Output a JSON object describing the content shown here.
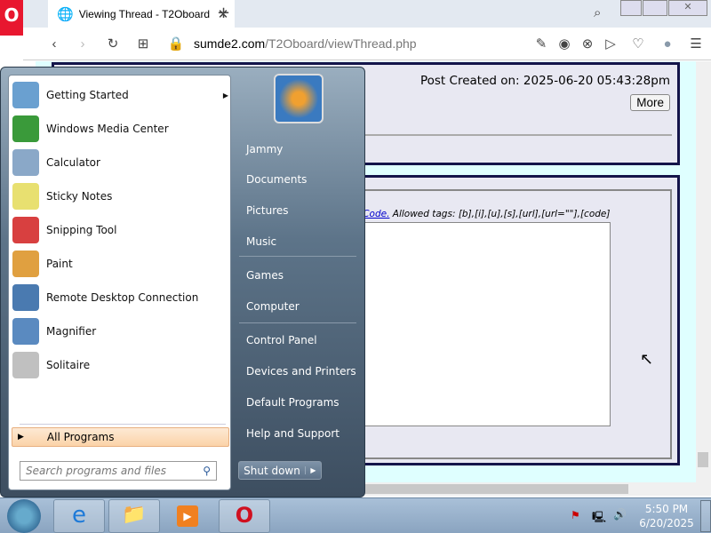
{
  "browser": {
    "tab_title": "Viewing Thread - T2Oboard",
    "url_domain": "sumde2.com",
    "url_path": "/T2Oboard/viewThread.php",
    "new_tab": "+"
  },
  "page": {
    "post_created": "Post Created on: 2025-06-20 05:43:28pm",
    "more_button": "More",
    "bbcode_link": "BCode.",
    "allowed_tags": "Allowed tags: [b],[i],[u],[s],[url],[url=\"\"],[code]"
  },
  "start_menu": {
    "programs": [
      {
        "label": "Getting Started",
        "color": "#6aa0d0"
      },
      {
        "label": "Windows Media Center",
        "color": "#3a9a3a"
      },
      {
        "label": "Calculator",
        "color": "#8aa8c8"
      },
      {
        "label": "Sticky Notes",
        "color": "#e8e070"
      },
      {
        "label": "Snipping Tool",
        "color": "#d84040"
      },
      {
        "label": "Paint",
        "color": "#e0a040"
      },
      {
        "label": "Remote Desktop Connection",
        "color": "#4a7ab0"
      },
      {
        "label": "Magnifier",
        "color": "#5a8ac0"
      },
      {
        "label": "Solitaire",
        "color": "#c0c0c0"
      }
    ],
    "all_programs": "All Programs",
    "search_placeholder": "Search programs and files",
    "right_items": [
      "Jammy",
      "Documents",
      "Pictures",
      "Music",
      "Games",
      "Computer",
      "Control Panel",
      "Devices and Printers",
      "Default Programs",
      "Help and Support"
    ],
    "shutdown": "Shut down"
  },
  "taskbar": {
    "time": "5:50 PM",
    "date": "6/20/2025"
  }
}
